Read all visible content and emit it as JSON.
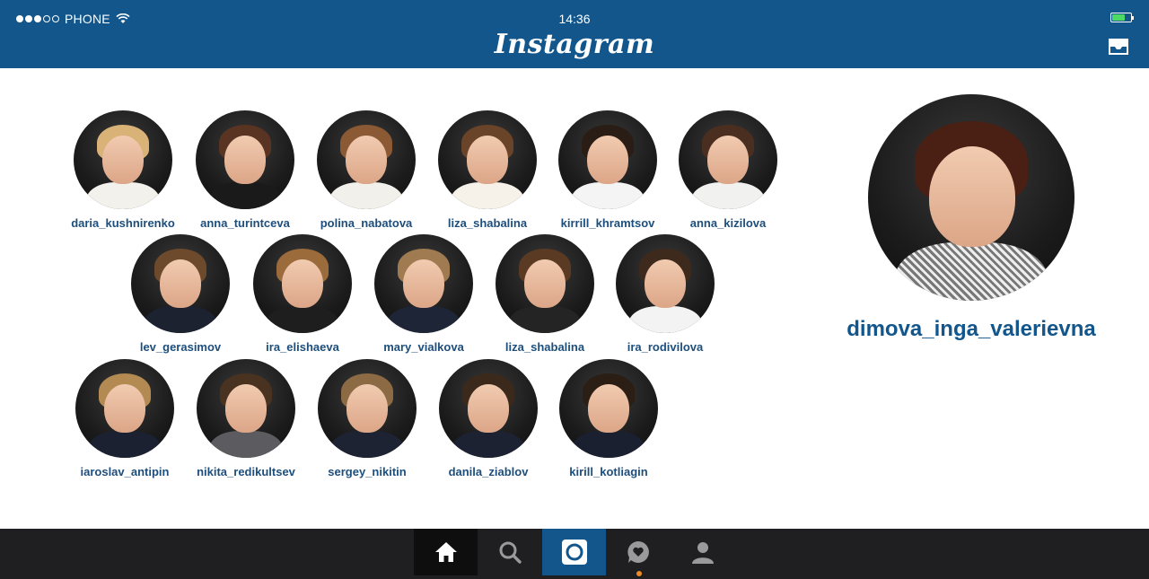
{
  "status_bar": {
    "carrier": "PHONE",
    "time": "14:36",
    "battery_level": 0.7
  },
  "header": {
    "app_title": "Instagram"
  },
  "students": [
    {
      "username": "daria_kushnirenko",
      "hair": "#d8b277",
      "body": "#f3f1ec"
    },
    {
      "username": "anna_turintceva",
      "hair": "#5a3422",
      "body": "#1a1a1a"
    },
    {
      "username": "polina_nabatova",
      "hair": "#8b5a35",
      "body": "#f2f0ea"
    },
    {
      "username": "liza_shabalina",
      "hair": "#6a4428",
      "body": "#f6f2ea"
    },
    {
      "username": "kirrill_khramtsov",
      "hair": "#2a1d15",
      "body": "#f4f4f4"
    },
    {
      "username": "anna_kizilova",
      "hair": "#4a2f20",
      "body": "#f1f1ef"
    },
    {
      "username": "lev_gerasimov",
      "hair": "#6e4a2c",
      "body": "#1c2230"
    },
    {
      "username": "ira_elishaeva",
      "hair": "#9b6b3c",
      "body": "#1e1e1e"
    },
    {
      "username": "mary_vialkova",
      "hair": "#a07a50",
      "body": "#1e2536"
    },
    {
      "username": "liza_shabalina",
      "hair": "#5b3a24",
      "body": "#242424"
    },
    {
      "username": "ira_rodivilova",
      "hair": "#3d2a1d",
      "body": "#f3f3f3"
    },
    {
      "username": "iaroslav_antipin",
      "hair": "#b48a53",
      "body": "#1b2130"
    },
    {
      "username": "nikita_redikultsev",
      "hair": "#4a3221",
      "body": "#5c5c60"
    },
    {
      "username": "sergey_nikitin",
      "hair": "#8c6a44",
      "body": "#1d2333"
    },
    {
      "username": "danila_ziablov",
      "hair": "#3b2a1c",
      "body": "#1c2232"
    },
    {
      "username": "kirill_kotliagin",
      "hair": "#2b1e15",
      "body": "#1b2030"
    }
  ],
  "teacher": {
    "username": "dimova_inga_valerievna",
    "hair": "#4a1f14",
    "body": "#777777"
  },
  "tabbar": {
    "active_tab": "home",
    "icons": [
      "home-icon",
      "search-icon",
      "camera-icon",
      "activity-icon",
      "profile-icon"
    ],
    "accent": "#12568c",
    "notification_color": "#f08a24"
  },
  "colors": {
    "header_bg": "#12568c",
    "username": "#1d4e7c",
    "tabbar_bg": "#1f1f21"
  }
}
